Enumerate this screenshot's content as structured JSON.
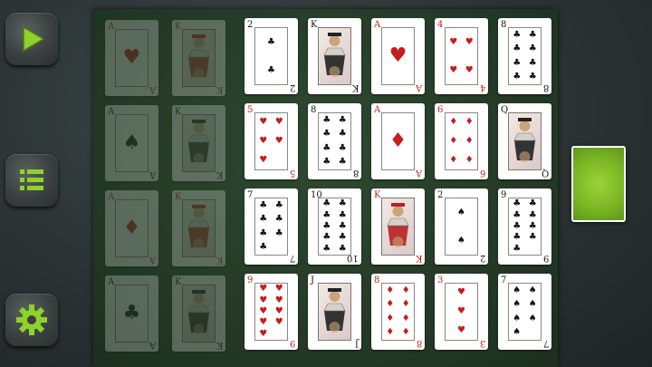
{
  "colors": {
    "accent": "#7bb824",
    "felt": "#243a26",
    "red_suit": "#c41e1e",
    "black_suit": "#151515"
  },
  "buttons": [
    {
      "name": "play-button",
      "icon": "play-icon"
    },
    {
      "name": "menu-button",
      "icon": "menu-list-icon"
    },
    {
      "name": "settings-button",
      "icon": "gear-icon"
    }
  ],
  "foundations": [
    {
      "rank": "A",
      "suit": "hearts"
    },
    {
      "rank": "K",
      "suit": "hearts"
    },
    {
      "rank": "A",
      "suit": "spades"
    },
    {
      "rank": "K",
      "suit": "spades"
    },
    {
      "rank": "A",
      "suit": "diamonds"
    },
    {
      "rank": "K",
      "suit": "diamonds"
    },
    {
      "rank": "A",
      "suit": "clubs"
    },
    {
      "rank": "K",
      "suit": "clubs"
    }
  ],
  "tableau": [
    [
      {
        "rank": "2",
        "suit": "clubs"
      },
      {
        "rank": "K",
        "suit": "clubs"
      },
      {
        "rank": "A",
        "suit": "hearts"
      },
      {
        "rank": "4",
        "suit": "hearts"
      },
      {
        "rank": "8",
        "suit": "clubs"
      }
    ],
    [
      {
        "rank": "5",
        "suit": "hearts"
      },
      {
        "rank": "8",
        "suit": "clubs"
      },
      {
        "rank": "A",
        "suit": "diamonds"
      },
      {
        "rank": "6",
        "suit": "diamonds"
      },
      {
        "rank": "Q",
        "suit": "spades"
      }
    ],
    [
      {
        "rank": "7",
        "suit": "clubs"
      },
      {
        "rank": "10",
        "suit": "clubs"
      },
      {
        "rank": "K",
        "suit": "hearts"
      },
      {
        "rank": "2",
        "suit": "spades"
      },
      {
        "rank": "9",
        "suit": "clubs"
      }
    ],
    [
      {
        "rank": "9",
        "suit": "hearts"
      },
      {
        "rank": "J",
        "suit": "spades"
      },
      {
        "rank": "8",
        "suit": "diamonds"
      },
      {
        "rank": "3",
        "suit": "hearts"
      },
      {
        "rank": "7",
        "suit": "spades"
      }
    ]
  ],
  "deck": {
    "face": "down",
    "back_color": "#7bb824"
  }
}
